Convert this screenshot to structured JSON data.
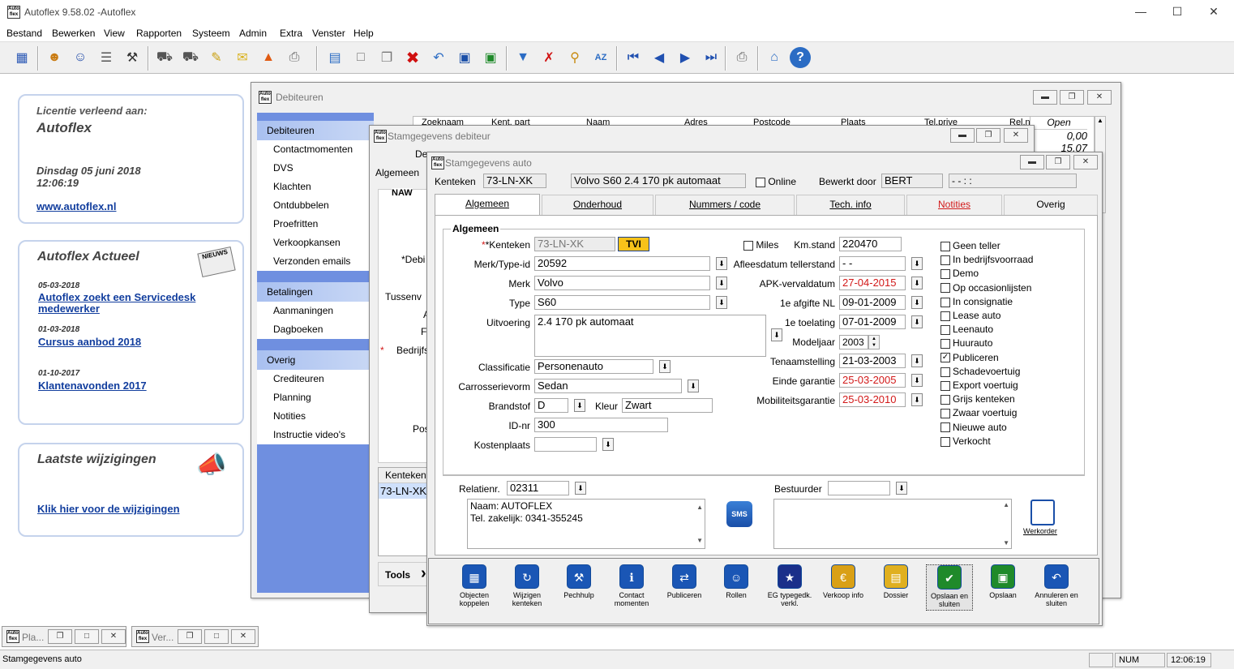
{
  "app": {
    "title": "Autoflex 9.58.02 -Autoflex",
    "logo": "Auto flex"
  },
  "menu": [
    "Bestand",
    "Bewerken",
    "View",
    "Rapporten",
    "Systeem",
    "Admin",
    "Extra",
    "Venster",
    "Help"
  ],
  "left": {
    "license": {
      "label": "Licentie verleend aan:",
      "name": "Autoflex",
      "date": "Dinsdag 05 juni 2018",
      "time": "12:06:19",
      "url": "www.autoflex.nl"
    },
    "news": {
      "title": "Autoflex Actueel",
      "items": [
        {
          "date": "05-03-2018",
          "text": "Autoflex zoekt een Servicedesk medewerker"
        },
        {
          "date": "01-03-2018",
          "text": "Cursus aanbod 2018"
        },
        {
          "date": "01-10-2017",
          "text": "Klantenavonden 2017"
        }
      ]
    },
    "changes": {
      "title": "Laatste wijzigingen",
      "link": "Klik hier voor de wijzigingen"
    }
  },
  "debiteuren": {
    "title": "Debiteuren",
    "nav": [
      {
        "head": "Debiteuren",
        "items": [
          "Contactmomenten",
          "DVS",
          "Klachten",
          "Ontdubbelen",
          "Proefritten",
          "Verkoopkansen",
          "Verzonden emails"
        ]
      },
      {
        "head": "Betalingen",
        "items": [
          "Aanmaningen",
          "Dagboeken"
        ]
      },
      {
        "head": "Overig",
        "items": [
          "Crediteuren",
          "Planning",
          "Notities",
          "Instructie video's"
        ]
      }
    ],
    "columns": [
      "Zoeknaam",
      "Kent. part",
      "Naam",
      "Adres",
      "Postcode",
      "Plaats",
      "Tel.prive",
      "Rel.nr",
      "Open"
    ],
    "open_values": [
      "0,00",
      "15,07"
    ]
  },
  "stam_deb": {
    "title": "Stamgegevens debiteur",
    "tab": "Algemeen",
    "naw": "NAW",
    "frag": [
      "De",
      "*Debi",
      "Tussenv",
      "A",
      "F",
      "Bedrijfs",
      "Pos"
    ],
    "kenteken_head": "Kenteken",
    "kenteken_val": "73-LN-XK",
    "tools": "Tools"
  },
  "stam_auto": {
    "title": "Stamgegevens auto",
    "top": {
      "kenteken_label": "Kenteken",
      "kenteken": "73-LN-XK",
      "omschrijving": "Volvo S60 2.4 170 pk automaat",
      "online": "Online",
      "bewerkt_label": "Bewerkt door",
      "bewerkt": "BERT",
      "stamp": "-   -        :   :"
    },
    "tabs": [
      "Algemeen",
      "Onderhoud",
      "Nummers / code",
      "Tech. info",
      "Notities",
      "Overig"
    ],
    "section": "Algemeen",
    "fields": {
      "kenteken_l": "*Kenteken",
      "kenteken": "73-LN-XK",
      "tvi": "TVI",
      "merktype_l": "Merk/Type-id",
      "merktype": "20592",
      "merk_l": "Merk",
      "merk": "Volvo",
      "type_l": "Type",
      "type": "S60",
      "uitvoering_l": "Uitvoering",
      "uitvoering": "2.4 170 pk automaat",
      "class_l": "Classificatie",
      "class": "Personenauto",
      "carr_l": "Carrosserievorm",
      "carr": "Sedan",
      "brand_l": "Brandstof",
      "brand": "D",
      "kleur_l": "Kleur",
      "kleur": "Zwart",
      "idnr_l": "ID-nr",
      "idnr": "300",
      "kost_l": "Kostenplaats",
      "kost": ""
    },
    "right": {
      "miles": "Miles",
      "km_l": "Km.stand",
      "km": "220470",
      "afl_l": "Afleesdatum tellerstand",
      "afl": "-  -",
      "apk_l": "APK-vervaldatum",
      "apk": "27-04-2015",
      "afgifte_l": "1e afgifte NL",
      "afgifte": "09-01-2009",
      "toel_l": "1e toelating",
      "toel": "07-01-2009",
      "model_l": "Modeljaar",
      "model": "2003",
      "tenaam_l": "Tenaamstelling",
      "tenaam": "21-03-2003",
      "garantie_l": "Einde garantie",
      "garantie": "25-03-2005",
      "mob_l": "Mobiliteitsgarantie",
      "mob": "25-03-2010"
    },
    "checks": [
      {
        "l": "Geen teller",
        "c": false
      },
      {
        "l": "In bedrijfsvoorraad",
        "c": false
      },
      {
        "l": "Demo",
        "c": false
      },
      {
        "l": "Op occasionlijsten",
        "c": false
      },
      {
        "l": "In consignatie",
        "c": false
      },
      {
        "l": "Lease auto",
        "c": false
      },
      {
        "l": "Leenauto",
        "c": false
      },
      {
        "l": "Huurauto",
        "c": false
      },
      {
        "l": "Publiceren",
        "c": true
      },
      {
        "l": "Schadevoertuig",
        "c": false
      },
      {
        "l": "Export voertuig",
        "c": false
      },
      {
        "l": "Grijs kenteken",
        "c": false
      },
      {
        "l": "Zwaar voertuig",
        "c": false
      },
      {
        "l": "Nieuwe auto",
        "c": false
      },
      {
        "l": "Verkocht",
        "c": false
      }
    ],
    "relatie": {
      "label": "Relatienr.",
      "nr": "02311",
      "line1": "Naam: AUTOFLEX",
      "line2": "Tel. zakelijk: 0341-355245",
      "sms": "SMS",
      "bestuurder": "Bestuurder",
      "werkorder": "Werkorder"
    },
    "buttons": [
      "Objecten koppelen",
      "Wijzigen kenteken",
      "Pechhulp",
      "Contact momenten",
      "Publiceren",
      "Rollen",
      "EG typegedk. verkl.",
      "Verkoop info",
      "Dossier",
      "Opslaan en sluiten",
      "Opslaan",
      "Annuleren en sluiten"
    ]
  },
  "tasks": [
    "Pla...",
    "Ver..."
  ],
  "status": {
    "text": "Stamgegevens auto",
    "num": "NUM",
    "time": "12:06:19"
  }
}
